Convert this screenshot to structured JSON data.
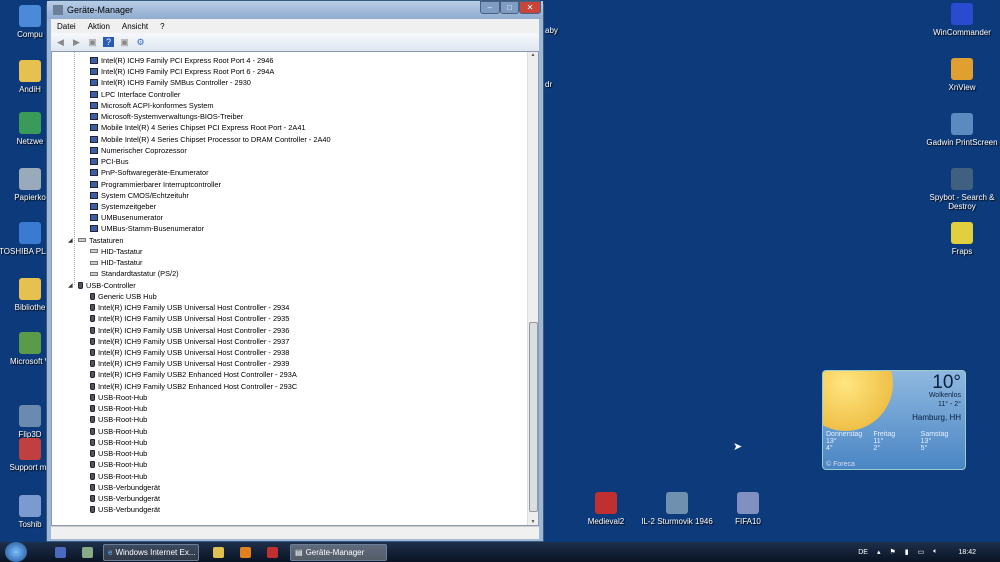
{
  "window": {
    "title": "Geräte-Manager",
    "menu": [
      "Datei",
      "Aktion",
      "Ansicht",
      "?"
    ],
    "controls": {
      "minimize": "–",
      "maximize": "□",
      "close": "✕"
    }
  },
  "tree": [
    {
      "level": 2,
      "type": "sys",
      "label": "Intel(R) ICH9 Family PCI Express Root Port 4 - 2946"
    },
    {
      "level": 2,
      "type": "sys",
      "label": "Intel(R) ICH9 Family PCI Express Root Port 6 - 294A"
    },
    {
      "level": 2,
      "type": "sys",
      "label": "Intel(R) ICH9 Family SMBus Controller - 2930"
    },
    {
      "level": 2,
      "type": "sys",
      "label": "LPC Interface Controller"
    },
    {
      "level": 2,
      "type": "sys",
      "label": "Microsoft ACPI-konformes System"
    },
    {
      "level": 2,
      "type": "sys",
      "label": "Microsoft-Systemverwaltungs-BIOS-Treiber"
    },
    {
      "level": 2,
      "type": "sys",
      "label": "Mobile Intel(R) 4 Series Chipset PCI Express Root Port - 2A41"
    },
    {
      "level": 2,
      "type": "sys",
      "label": "Mobile Intel(R) 4 Series Chipset Processor to DRAM Controller - 2A40"
    },
    {
      "level": 2,
      "type": "sys",
      "label": "Numerischer Coprozessor"
    },
    {
      "level": 2,
      "type": "sys",
      "label": "PCI-Bus"
    },
    {
      "level": 2,
      "type": "sys",
      "label": "PnP-Softwaregeräte-Enumerator"
    },
    {
      "level": 2,
      "type": "sys",
      "label": "Programmierbarer Interruptcontroller"
    },
    {
      "level": 2,
      "type": "sys",
      "label": "System CMOS/Echtzeituhr"
    },
    {
      "level": 2,
      "type": "sys",
      "label": "Systemzeitgeber"
    },
    {
      "level": 2,
      "type": "sys",
      "label": "UMBusenumerator"
    },
    {
      "level": 2,
      "type": "sys",
      "label": "UMBus-Stamm-Busenumerator"
    },
    {
      "level": 1,
      "type": "kb",
      "label": "Tastaturen"
    },
    {
      "level": 2,
      "type": "kb",
      "label": "HID-Tastatur"
    },
    {
      "level": 2,
      "type": "kb",
      "label": "HID-Tastatur"
    },
    {
      "level": 2,
      "type": "kb",
      "label": "Standardtastatur (PS/2)"
    },
    {
      "level": 1,
      "type": "usb",
      "label": "USB-Controller"
    },
    {
      "level": 2,
      "type": "usb",
      "label": "Generic USB Hub"
    },
    {
      "level": 2,
      "type": "usb",
      "label": "Intel(R) ICH9 Family USB Universal Host Controller - 2934"
    },
    {
      "level": 2,
      "type": "usb",
      "label": "Intel(R) ICH9 Family USB Universal Host Controller - 2935"
    },
    {
      "level": 2,
      "type": "usb",
      "label": "Intel(R) ICH9 Family USB Universal Host Controller - 2936"
    },
    {
      "level": 2,
      "type": "usb",
      "label": "Intel(R) ICH9 Family USB Universal Host Controller - 2937"
    },
    {
      "level": 2,
      "type": "usb",
      "label": "Intel(R) ICH9 Family USB Universal Host Controller - 2938"
    },
    {
      "level": 2,
      "type": "usb",
      "label": "Intel(R) ICH9 Family USB Universal Host Controller - 2939"
    },
    {
      "level": 2,
      "type": "usb",
      "label": "Intel(R) ICH9 Family USB2 Enhanced Host Controller - 293A"
    },
    {
      "level": 2,
      "type": "usb",
      "label": "Intel(R) ICH9 Family USB2 Enhanced Host Controller - 293C"
    },
    {
      "level": 2,
      "type": "usb",
      "label": "USB-Root-Hub"
    },
    {
      "level": 2,
      "type": "usb",
      "label": "USB-Root-Hub"
    },
    {
      "level": 2,
      "type": "usb",
      "label": "USB-Root-Hub"
    },
    {
      "level": 2,
      "type": "usb",
      "label": "USB-Root-Hub"
    },
    {
      "level": 2,
      "type": "usb",
      "label": "USB-Root-Hub"
    },
    {
      "level": 2,
      "type": "usb",
      "label": "USB-Root-Hub"
    },
    {
      "level": 2,
      "type": "usb",
      "label": "USB-Root-Hub"
    },
    {
      "level": 2,
      "type": "usb",
      "label": "USB-Root-Hub"
    },
    {
      "level": 2,
      "type": "usb",
      "label": "USB-Verbundgerät"
    },
    {
      "level": 2,
      "type": "usb",
      "label": "USB-Verbundgerät"
    },
    {
      "level": 2,
      "type": "usb",
      "label": "USB-Verbundgerät"
    }
  ],
  "desktop_left": [
    {
      "label": "Compu",
      "color": "#4a8ad8"
    },
    {
      "label": "AndiH",
      "color": "#e8c050"
    },
    {
      "label": "Netzwe",
      "color": "#3a9a5a"
    },
    {
      "label": "Papierko",
      "color": "#9ab"
    },
    {
      "label": "TOSHIBA PLAYE",
      "color": "#3a7ad0"
    },
    {
      "label": "Bibliothe",
      "color": "#e8c050"
    },
    {
      "label": "Microsoft V",
      "color": "#5a9a4a"
    },
    {
      "label": "Flip3D",
      "color": "#6a8ab0"
    },
    {
      "label": "Support my",
      "color": "#c04040"
    },
    {
      "label": "Toshib",
      "color": "#7a9ad0"
    }
  ],
  "desktop_right": [
    {
      "label": "WinCommander",
      "color": "#2a4ad0"
    },
    {
      "label": "XnView",
      "color": "#e0a030"
    },
    {
      "label": "Gadwin PrintScreen",
      "color": "#5a8ac0"
    },
    {
      "label": "Spybot - Search & Destroy",
      "color": "#406080"
    },
    {
      "label": "Fraps",
      "color": "#e0d040"
    }
  ],
  "desktop_partial": [
    "aby",
    "dr"
  ],
  "desktop_bottom": [
    {
      "label": "Medieval2",
      "color": "#c03030"
    },
    {
      "label": "IL-2 Sturmovik 1946",
      "color": "#7090b0"
    },
    {
      "label": "FIFA10",
      "color": "#8090c0"
    }
  ],
  "weather": {
    "temp": "10°",
    "condition": "Wolkenlos",
    "range": "11° - 2°",
    "city": "Hamburg, HH",
    "days": [
      {
        "name": "Donnerstag",
        "hi": "13°",
        "lo": "4°"
      },
      {
        "name": "Freitag",
        "hi": "11°",
        "lo": "2°"
      },
      {
        "name": "Samstag",
        "hi": "13°",
        "lo": "5°"
      }
    ],
    "credit": "© Foreca"
  },
  "taskbar": {
    "tasks": [
      "Windows Internet Ex...",
      "Geräte-Manager"
    ],
    "lang": "DE",
    "time": "18:42"
  }
}
